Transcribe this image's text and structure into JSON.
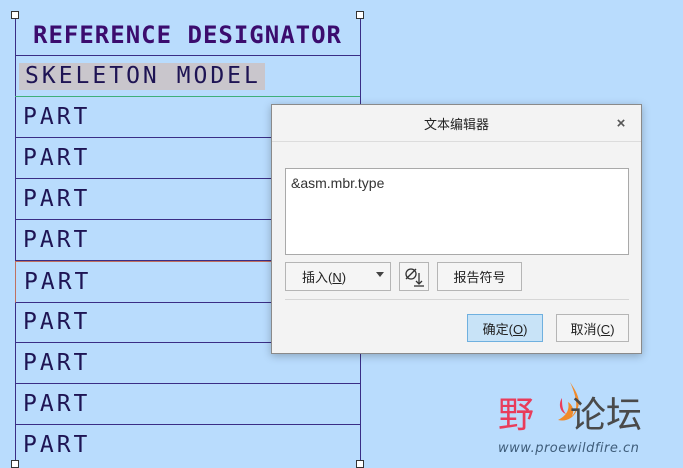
{
  "table": {
    "header": "REFERENCE DESIGNATOR",
    "rows": [
      "SKELETON MODEL",
      "PART",
      "PART",
      "PART",
      "PART",
      "PART",
      "PART",
      "PART",
      "PART",
      "PART"
    ]
  },
  "dialog": {
    "title": "文本编辑器",
    "close_glyph": "×",
    "editor_value": "&asm.mbr.type",
    "insert_label": "插入(",
    "insert_key": "N",
    "insert_suffix": ")",
    "report_symbols_label": "报告符号",
    "ok_label": "确定(",
    "ok_key": "O",
    "ok_suffix": ")",
    "cancel_label": "取消(",
    "cancel_key": "C",
    "cancel_suffix": ")"
  },
  "watermark": {
    "chinese_part1": "野",
    "chinese_part2": "论坛",
    "url": "www.proewildfire.cn"
  },
  "colors": {
    "background": "#b9dcfd",
    "table_line": "#3a2e86",
    "text": "#1e1454",
    "header_text": "#3b0c6e",
    "selected_row_border": "#c07060",
    "skeleton_row_border": "#3fb07a",
    "ok_button": "#c8e3f7",
    "watermark_red": "#e93c5b"
  }
}
